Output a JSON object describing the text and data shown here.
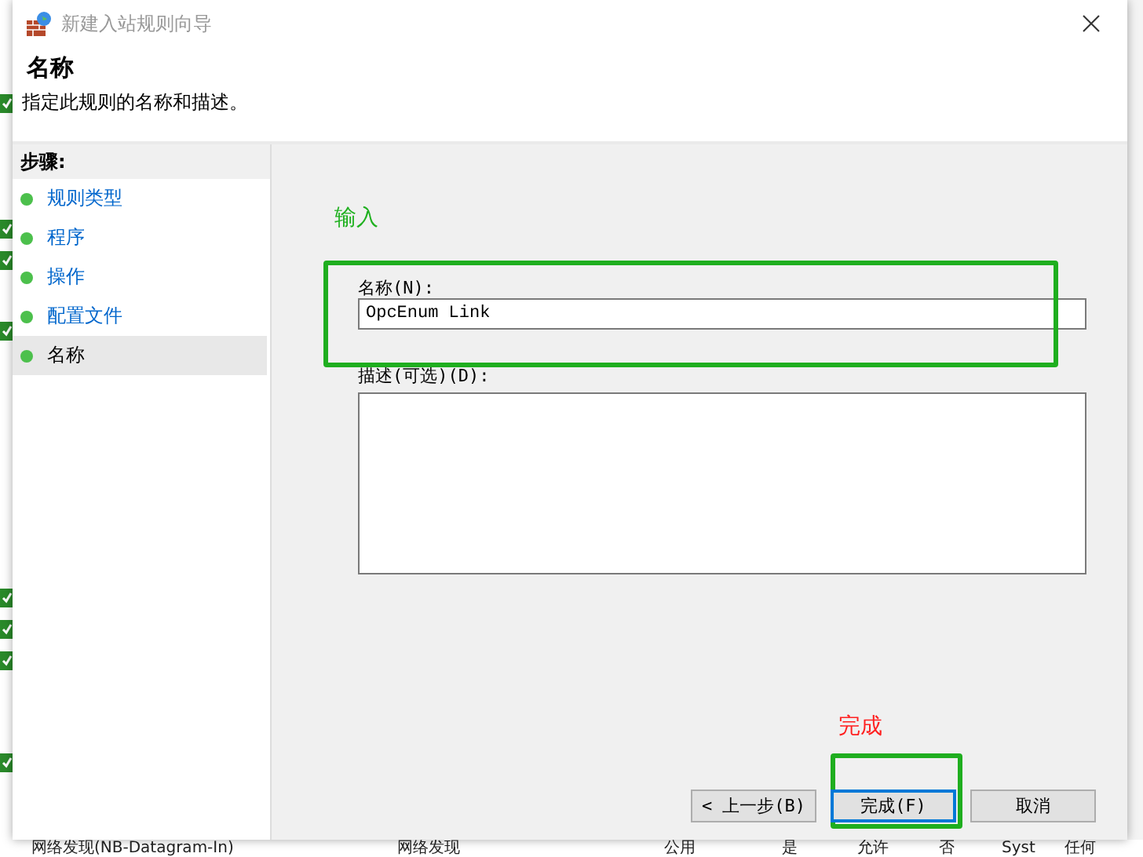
{
  "window": {
    "title": "新建入站规则向导"
  },
  "header": {
    "title": "名称",
    "subtitle": "指定此规则的名称和描述。"
  },
  "steps": {
    "heading": "步骤:",
    "items": [
      {
        "label": "规则类型",
        "selected": false
      },
      {
        "label": "程序",
        "selected": false
      },
      {
        "label": "操作",
        "selected": false
      },
      {
        "label": "配置文件",
        "selected": false
      },
      {
        "label": "名称",
        "selected": true
      }
    ]
  },
  "form": {
    "name_label": "名称(N):",
    "name_value": "OpcEnum Link",
    "description_label": "描述(可选)(D):"
  },
  "annotations": {
    "input_note": "输入",
    "finish_note": "完成"
  },
  "buttons": [
    {
      "label": "< 上一步(B)",
      "selected": false
    },
    {
      "label": "完成(F)",
      "selected": true
    },
    {
      "label": "取消",
      "selected": false
    }
  ],
  "background_row": [
    "网络发现(NB-Datagram-In)",
    "网络发现",
    "公用",
    "是",
    "允许",
    "否",
    "Syst",
    "任何"
  ]
}
